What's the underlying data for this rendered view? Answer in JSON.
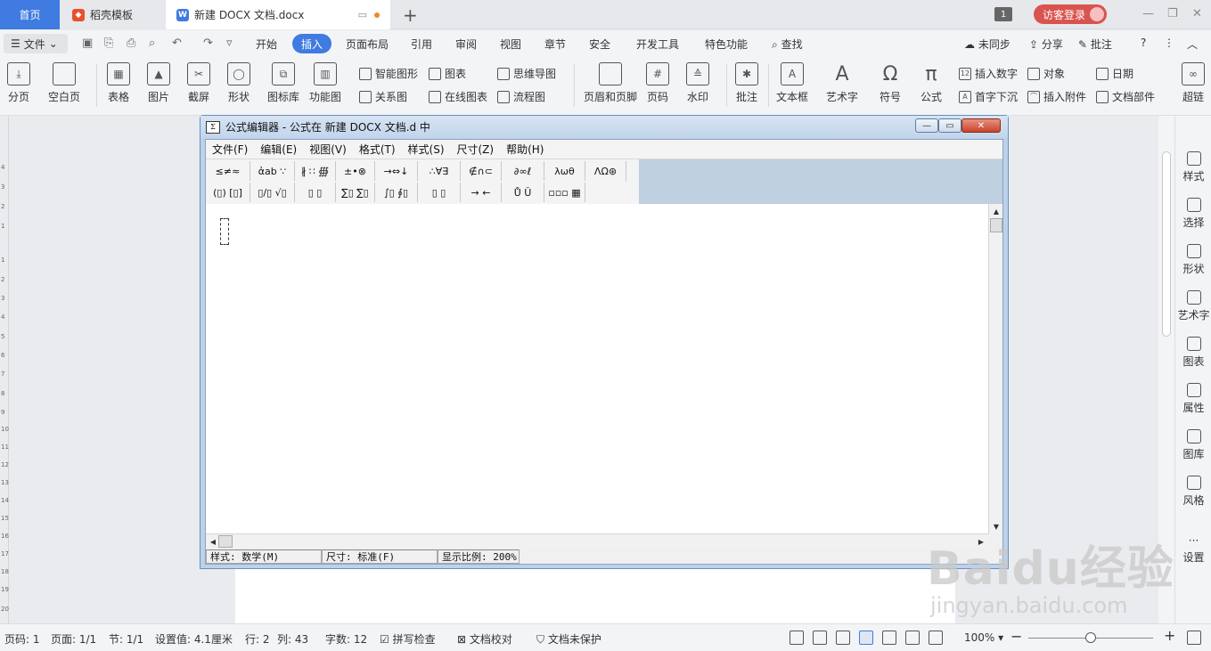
{
  "tabs": {
    "home": "首页",
    "template": "稻壳模板",
    "doc": "新建 DOCX 文档.docx",
    "count_badge": "1",
    "login": "访客登录"
  },
  "menu": {
    "file": "文件",
    "items": [
      "开始",
      "插入",
      "页面布局",
      "引用",
      "审阅",
      "视图",
      "章节",
      "安全",
      "开发工具",
      "特色功能"
    ],
    "active": "插入",
    "search": "查找",
    "sync": "未同步",
    "share": "分享",
    "comment": "批注"
  },
  "ribbon": {
    "page_break": "分页",
    "blank_page": "空白页",
    "table": "表格",
    "picture": "图片",
    "screenshot": "截屏",
    "shape": "形状",
    "icon_lib": "图标库",
    "func_chart": "功能图",
    "smart_graphic": "智能图形",
    "chart": "图表",
    "mindmap": "思维导图",
    "relation": "关系图",
    "online_chart": "在线图表",
    "flowchart": "流程图",
    "header_footer": "页眉和页脚",
    "page_number": "页码",
    "watermark": "水印",
    "annotation": "批注",
    "textbox": "文本框",
    "wordart": "艺术字",
    "symbol": "符号",
    "formula": "公式",
    "insert_number": "插入数字",
    "object": "对象",
    "date": "日期",
    "drop_cap": "首字下沉",
    "attachment": "插入附件",
    "doc_parts": "文档部件",
    "hyperlink": "超链"
  },
  "sidebar": {
    "items": [
      "样式",
      "选择",
      "形状",
      "艺术字",
      "图表",
      "属性",
      "图库",
      "风格",
      "设置"
    ]
  },
  "ruler": [
    "4",
    "3",
    "2",
    "1",
    "1",
    "2",
    "3",
    "4",
    "5",
    "6",
    "7",
    "8",
    "9",
    "10",
    "11",
    "12",
    "13",
    "14",
    "15",
    "16",
    "17",
    "18",
    "19",
    "20"
  ],
  "statusbar": {
    "page_no": "页码: 1",
    "pages": "页面: 1/1",
    "section": "节: 1/1",
    "setting": "设置值: 4.1厘米",
    "row": "行: 2",
    "col": "列: 43",
    "wordcount": "字数: 12",
    "spellcheck": "拼写检查",
    "proofread": "文档校对",
    "protect": "文档未保护",
    "zoom": "100%",
    "zoom_level": 0.5
  },
  "equation_editor": {
    "title": "公式编辑器 - 公式在 新建 DOCX 文档.d 中",
    "menus": [
      "文件(F)",
      "编辑(E)",
      "视图(V)",
      "格式(T)",
      "样式(S)",
      "尺寸(Z)",
      "帮助(H)"
    ],
    "palette_row1": [
      "≤≠≈",
      "ἀab ∵",
      "∦ ∷ ∰",
      "±•⊗",
      "→⇔↓",
      "∴∀∃",
      "∉∩⊂",
      "∂∞ℓ",
      "λωθ",
      "ΛΩ⊛"
    ],
    "palette_row2": [
      "(▯) [▯]",
      "▯/▯ √▯",
      "▯ ▯",
      "∑▯ ∑▯",
      "∫▯ ∮▯",
      "▯ ▯",
      "→ ←",
      "Ů Ǔ",
      "▫▫▫ ▦"
    ],
    "status_style": "样式: 数学(M)",
    "status_size": "尺寸: 标准(F)",
    "status_zoom": "显示比例: 200%"
  },
  "watermark": {
    "brand": "Baidu经验",
    "url": "jingyan.baidu.com"
  }
}
